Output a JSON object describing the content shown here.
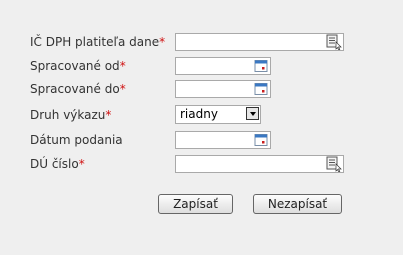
{
  "fields": [
    {
      "label": "IČ DPH platiteľa dane",
      "required_mark": "*",
      "value": "",
      "icon": "list-lookup-icon"
    },
    {
      "label": "Spracované od",
      "required_mark": "*",
      "value": "",
      "icon": "calendar-icon"
    },
    {
      "label": "Spracované do",
      "required_mark": "*",
      "value": "",
      "icon": "calendar-icon"
    },
    {
      "label": "Druh výkazu",
      "required_mark": "*",
      "value": "riadny",
      "icon": "dropdown-arrow-icon"
    },
    {
      "label": "Dátum podania",
      "required_mark": "",
      "value": "",
      "icon": "calendar-icon"
    },
    {
      "label": "DÚ číslo",
      "required_mark": "*",
      "value": "",
      "icon": "list-lookup-icon"
    }
  ],
  "buttons": {
    "save": "Zapísať",
    "cancel": "Nezapísať"
  },
  "colors": {
    "background": "#efefef",
    "required": "#d01010",
    "calendar_accent": "#3a78c3",
    "calendar_dot": "#c81e1e"
  }
}
